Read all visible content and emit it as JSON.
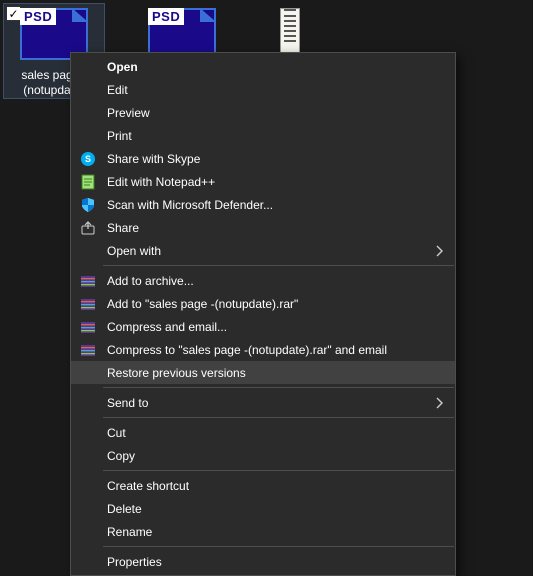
{
  "files": [
    {
      "type": "psd",
      "psd_tag": "PSD",
      "name": "sales page -(notupdate)",
      "selected": true,
      "checked": true
    },
    {
      "type": "psd",
      "psd_tag": "PSD",
      "name": "",
      "selected": false,
      "checked": false
    },
    {
      "type": "txt",
      "name": "",
      "selected": false,
      "checked": false
    }
  ],
  "menu": {
    "open": "Open",
    "edit": "Edit",
    "preview": "Preview",
    "print": "Print",
    "skype": "Share with Skype",
    "notepadpp": "Edit with Notepad++",
    "defender": "Scan with Microsoft Defender...",
    "share": "Share",
    "openwith": "Open with",
    "add_archive": "Add to archive...",
    "add_named": "Add to \"sales page -(notupdate).rar\"",
    "compress_email": "Compress and email...",
    "compress_named_email": "Compress to \"sales page -(notupdate).rar\" and email",
    "restore": "Restore previous versions",
    "sendto": "Send to",
    "cut": "Cut",
    "copy": "Copy",
    "shortcut": "Create shortcut",
    "delete": "Delete",
    "rename": "Rename",
    "properties": "Properties"
  }
}
